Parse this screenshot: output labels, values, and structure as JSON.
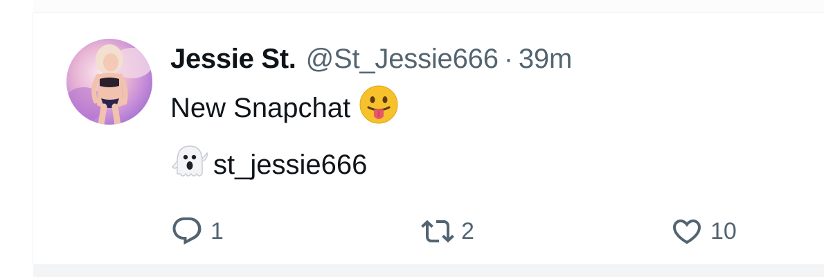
{
  "tweet": {
    "author": {
      "display_name": "Jessie St.",
      "handle": "@St_Jessie666",
      "separator": "·",
      "time": "39m",
      "avatar_icon": "profile-photo"
    },
    "body": {
      "line1_text": "New Snapchat",
      "line1_emoji": "face-with-tongue-emoji",
      "line2_emoji": "ghost-emoji",
      "line2_text": "st_jessie666"
    },
    "actions": {
      "reply": {
        "icon": "reply-icon",
        "count": "1"
      },
      "retweet": {
        "icon": "retweet-icon",
        "count": "2"
      },
      "like": {
        "icon": "heart-icon",
        "count": "10"
      }
    }
  },
  "colors": {
    "primary_text": "#0f1419",
    "secondary_text": "#536471",
    "border": "#eef0f2"
  }
}
